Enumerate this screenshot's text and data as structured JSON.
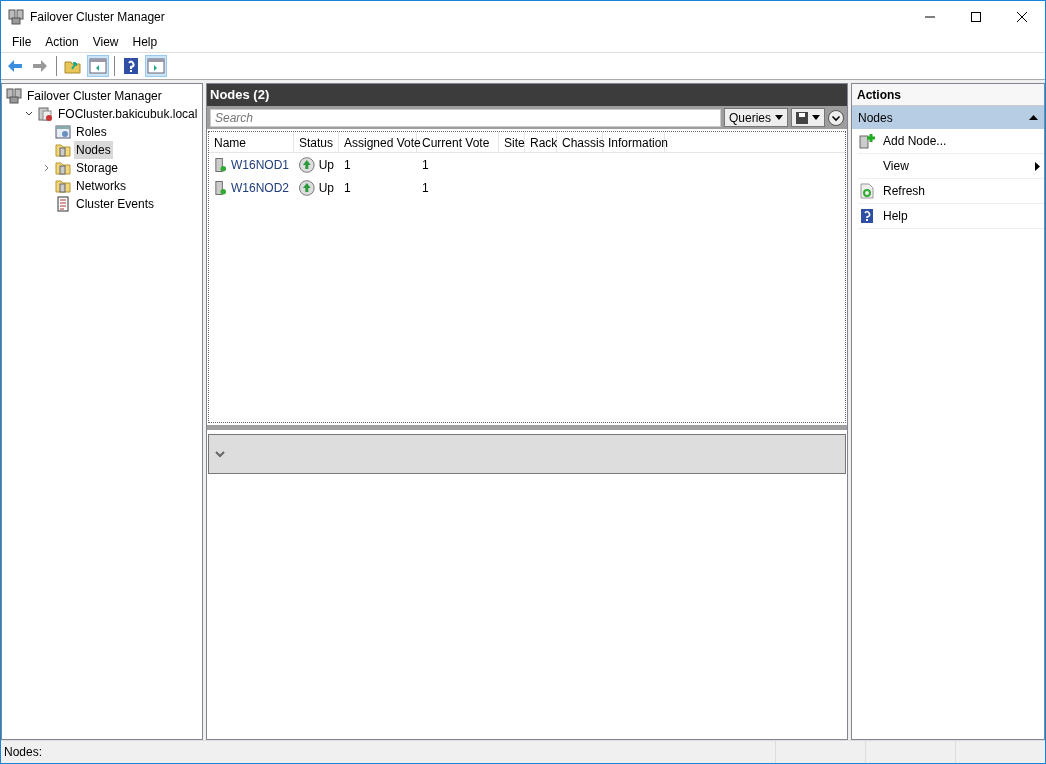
{
  "window": {
    "title": "Failover Cluster Manager"
  },
  "menu": [
    "File",
    "Action",
    "View",
    "Help"
  ],
  "toolbar": [
    {
      "kind": "back",
      "pressed": false
    },
    {
      "kind": "forward",
      "pressed": false
    },
    {
      "kind": "sep"
    },
    {
      "kind": "up",
      "pressed": false
    },
    {
      "kind": "pane",
      "pressed": true
    },
    {
      "kind": "sep"
    },
    {
      "kind": "help",
      "pressed": false
    },
    {
      "kind": "pane2",
      "pressed": true
    }
  ],
  "tree": [
    {
      "label": "Failover Cluster Manager",
      "kind": "cluster",
      "selected": false,
      "children": [
        {
          "label": "FOCluster.bakicubuk.local",
          "kind": "clusternode",
          "selected": false,
          "expanded": true,
          "children": [
            {
              "label": "Roles",
              "kind": "roles",
              "selected": false
            },
            {
              "label": "Nodes",
              "kind": "folder",
              "selected": true
            },
            {
              "label": "Storage",
              "kind": "folder",
              "selected": false,
              "expanded": false
            },
            {
              "label": "Networks",
              "kind": "folder",
              "selected": false
            },
            {
              "label": "Cluster Events",
              "kind": "events",
              "selected": false
            }
          ]
        }
      ]
    }
  ],
  "panel": {
    "title": "Nodes (2)",
    "search": {
      "placeholder": "Search"
    },
    "queries": "Queries",
    "columns": [
      "Name",
      "Status",
      "Assigned Vote",
      "Current Vote",
      "Site",
      "Rack",
      "Chassis",
      "Information"
    ],
    "rows": [
      {
        "name": "W16NOD1",
        "status": "Up",
        "assigned_vote": "1",
        "current_vote": "1"
      },
      {
        "name": "W16NOD2",
        "status": "Up",
        "assigned_vote": "1",
        "current_vote": "1"
      }
    ],
    "details": {
      "expanded": false
    }
  },
  "actions": {
    "title": "Actions",
    "section": {
      "title": "Nodes",
      "expanded": true
    },
    "items": [
      {
        "label": "Add Node...",
        "kind": "add"
      },
      {
        "label": "View",
        "kind": "submenu"
      },
      {
        "label": "Refresh",
        "kind": "refresh"
      },
      {
        "label": "Help",
        "kind": "help"
      }
    ]
  },
  "status_bar": "Nodes:"
}
